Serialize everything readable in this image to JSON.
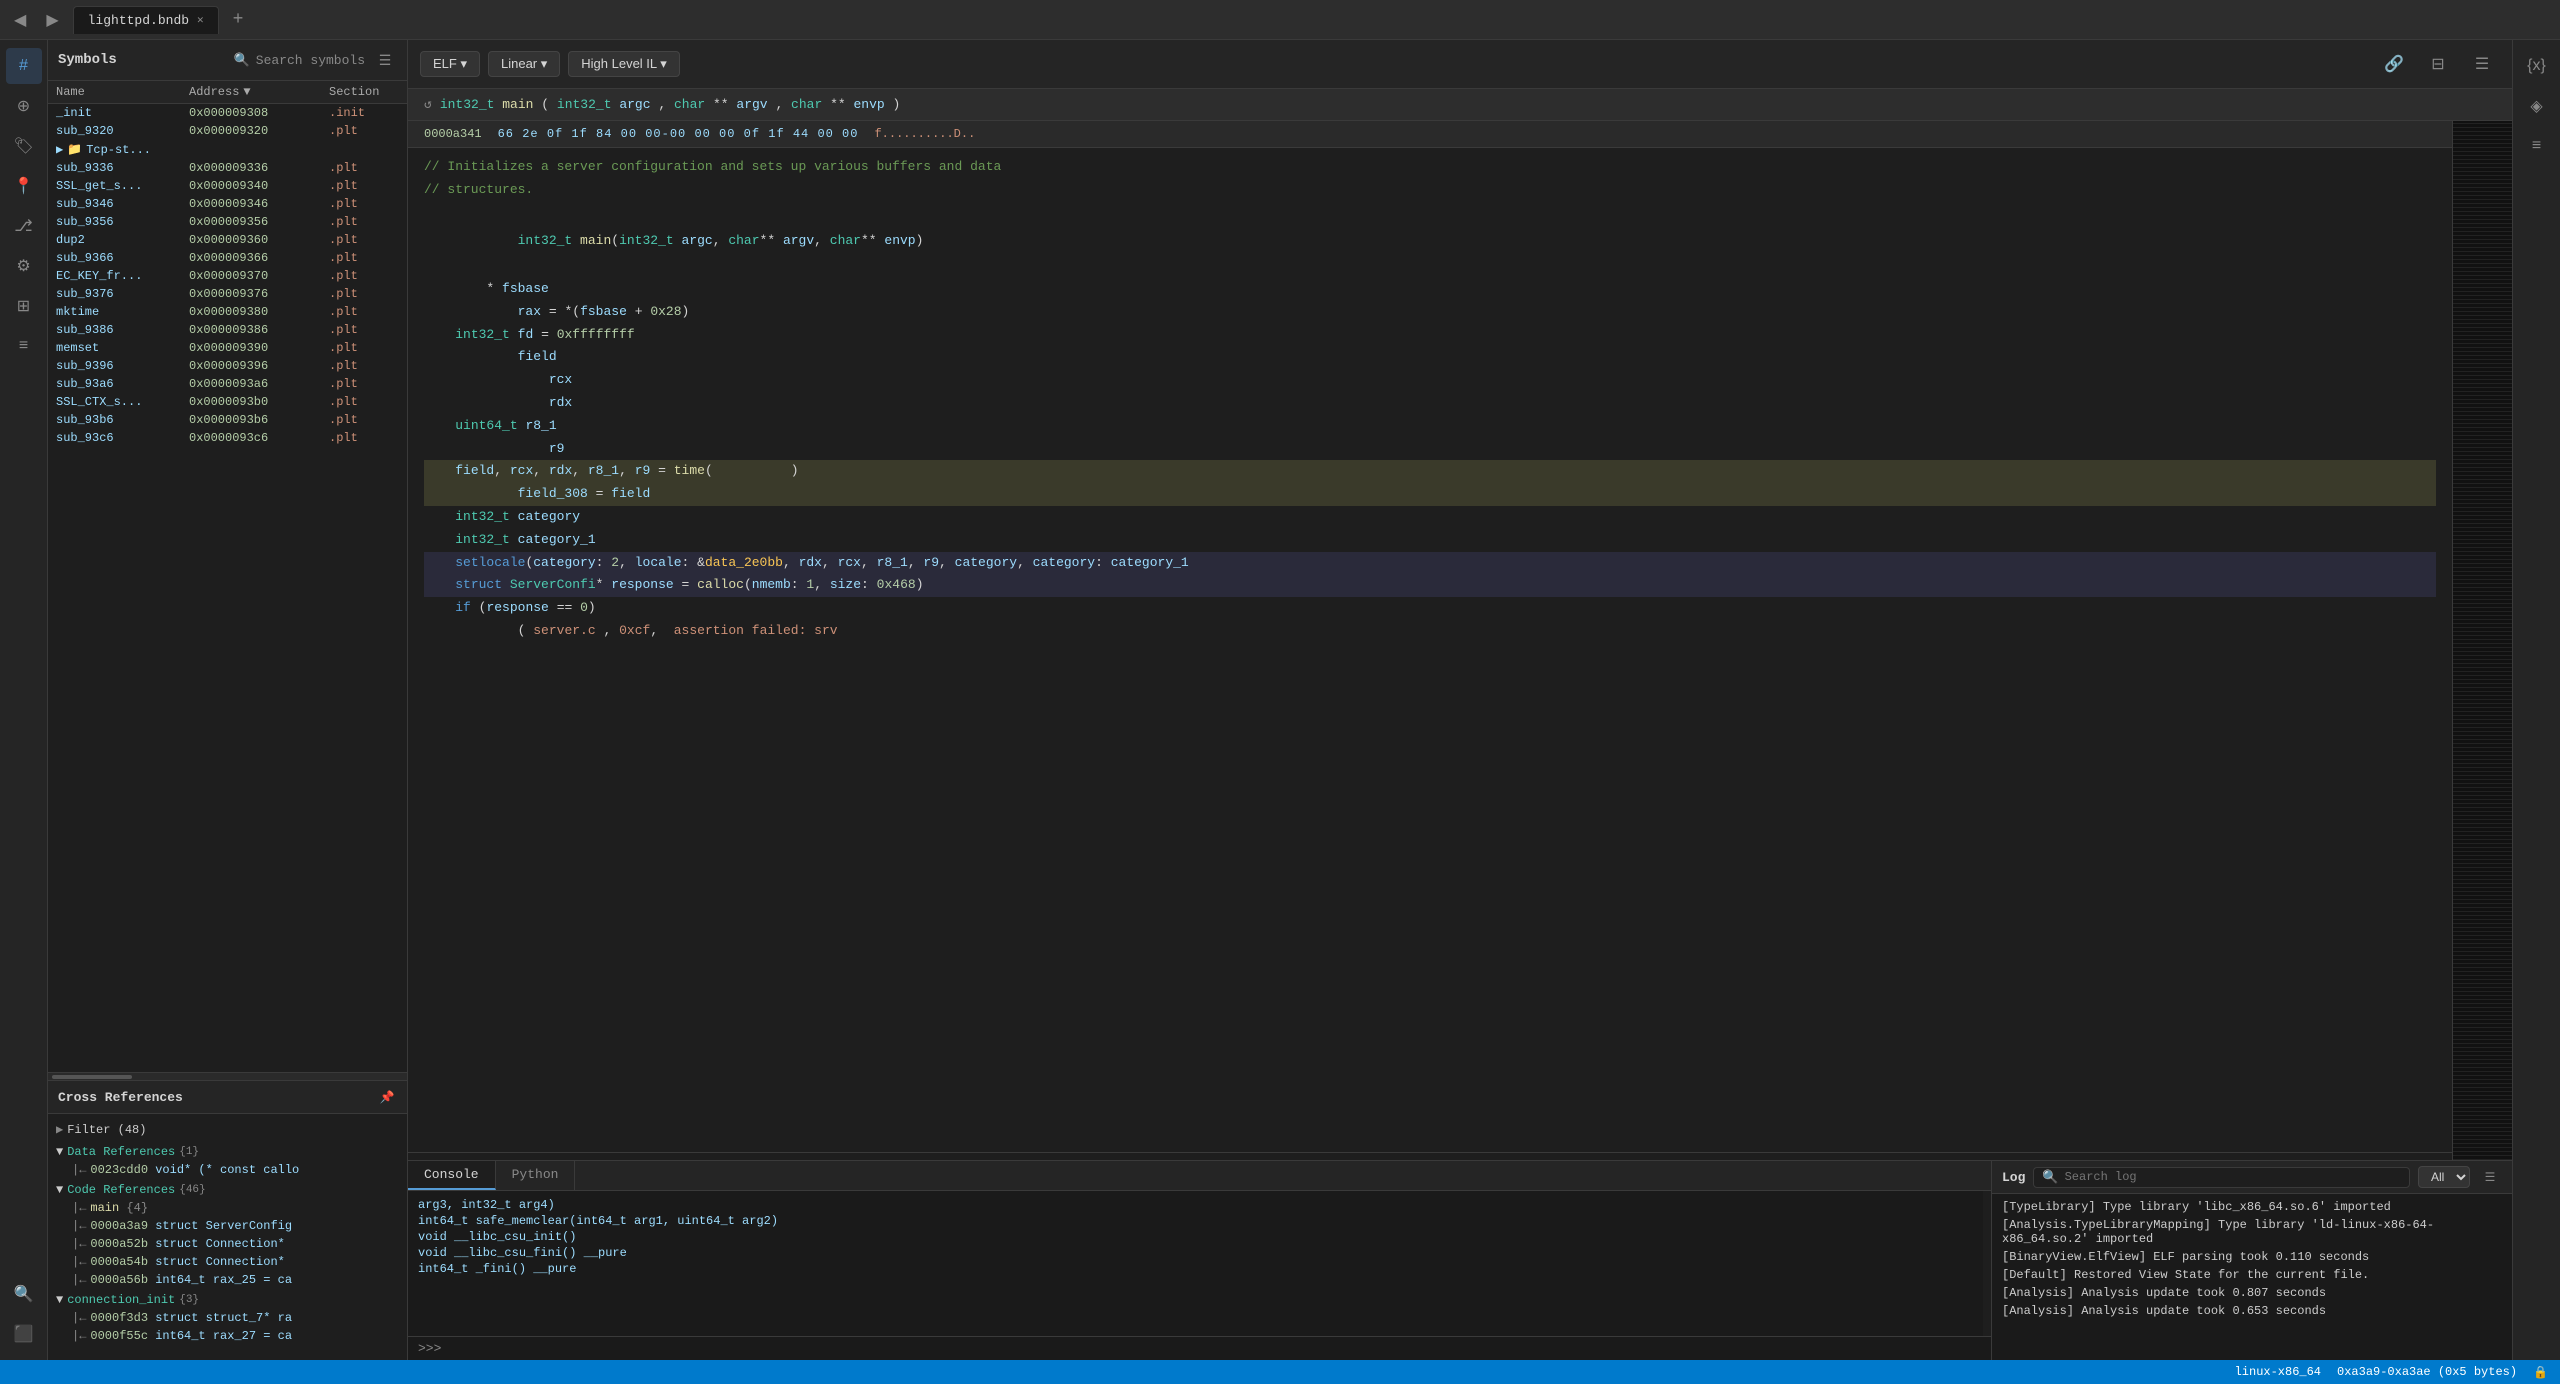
{
  "topbar": {
    "back_label": "◀",
    "forward_label": "▶",
    "tab_name": "lighttpd.bndb",
    "tab_close": "✕",
    "tab_add": "+"
  },
  "toolbar": {
    "elf_label": "ELF ▾",
    "linear_label": "Linear ▾",
    "hlil_label": "High Level IL ▾",
    "link_icon": "🔗",
    "split_icon": "⊟",
    "menu_icon": "☰"
  },
  "func_sig": {
    "refresh_icon": "↺",
    "signature": "int32_t main(int32_t argc, char** argv, char** envp)"
  },
  "hex_row": {
    "addr": "0000a341",
    "bytes": "66 2e 0f 1f 84 00 00-00 00 00 0f 1f 44 00 00",
    "ascii": "f..........D.."
  },
  "symbols": {
    "title": "Symbols",
    "search_placeholder": "Search symbols",
    "columns": [
      "Name",
      "Address",
      "Section"
    ],
    "rows": [
      {
        "name": "_init",
        "addr": "0x000009308",
        "section": ".init"
      },
      {
        "name": "sub_9320",
        "addr": "0x000009320",
        "section": ".plt"
      },
      {
        "name": "Tcp-st...",
        "addr": "",
        "section": "",
        "is_folder": true
      },
      {
        "name": "sub_9336",
        "addr": "0x000009336",
        "section": ".plt"
      },
      {
        "name": "SSL_get_s...",
        "addr": "0x000009340",
        "section": ".plt"
      },
      {
        "name": "sub_9346",
        "addr": "0x000009346",
        "section": ".plt"
      },
      {
        "name": "sub_9356",
        "addr": "0x000009356",
        "section": ".plt"
      },
      {
        "name": "dup2",
        "addr": "0x000009360",
        "section": ".plt"
      },
      {
        "name": "sub_9366",
        "addr": "0x000009366",
        "section": ".plt"
      },
      {
        "name": "EC_KEY_fr...",
        "addr": "0x000009370",
        "section": ".plt"
      },
      {
        "name": "sub_9376",
        "addr": "0x000009376",
        "section": ".plt"
      },
      {
        "name": "mktime",
        "addr": "0x000009380",
        "section": ".plt"
      },
      {
        "name": "sub_9386",
        "addr": "0x000009386",
        "section": ".plt"
      },
      {
        "name": "memset",
        "addr": "0x000009390",
        "section": ".plt"
      },
      {
        "name": "sub_9396",
        "addr": "0x000009396",
        "section": ".plt"
      },
      {
        "name": "sub_93a6",
        "addr": "0x0000093a6",
        "section": ".plt"
      },
      {
        "name": "SSL_CTX_s...",
        "addr": "0x0000093b0",
        "section": ".plt"
      },
      {
        "name": "sub_93b6",
        "addr": "0x0000093b6",
        "section": ".plt"
      },
      {
        "name": "sub_93c6",
        "addr": "0x0000093c6",
        "section": ".plt"
      }
    ]
  },
  "cross_refs": {
    "title": "Cross References",
    "filter_label": "Filter (48)",
    "sections": [
      {
        "name": "Data References",
        "count": "{1}",
        "items": [
          "0023cdd0 void* (* const callo"
        ]
      },
      {
        "name": "Code References",
        "count": "{46}",
        "items": [
          "main  {4}",
          "0000a3a9 struct ServerConfig",
          "0000a52b struct Connection*",
          "0000a54b struct Connection*",
          "0000a56b int64_t rax_25 = ca"
        ]
      },
      {
        "name": "connection_init",
        "count": "{3}",
        "items": [
          "0000f3d3 struct struct_7* ra",
          "0000f55c int64_t rax_27 = ca"
        ]
      }
    ]
  },
  "code": {
    "comment1": "// Initializes a server configuration and sets up various buffers and data",
    "comment2": "// structures.",
    "lines": [
      {
        "type": "sig",
        "text": "int32_t main(int32_t argc, char** argv, char** envp) {"
      },
      {
        "type": "code",
        "text": "    * fsbase"
      },
      {
        "type": "code",
        "text": "        rax = *(fsbase + 0x28)"
      },
      {
        "type": "code",
        "text": "    int32_t fd = 0xffffffff"
      },
      {
        "type": "code",
        "text": "        field"
      },
      {
        "type": "code",
        "text": "            rcx"
      },
      {
        "type": "code",
        "text": "            rdx"
      },
      {
        "type": "code",
        "text": "    uint64_t r8_1"
      },
      {
        "type": "code",
        "text": "            r9"
      },
      {
        "type": "code_hl",
        "text": "    field, rcx, rdx, r8_1, r9 = time(          )"
      },
      {
        "type": "code_hl",
        "text": "        field_308 = field"
      },
      {
        "type": "code",
        "text": "    int32_t category"
      },
      {
        "type": "code",
        "text": "    int32_t category_1"
      },
      {
        "type": "code_hl2",
        "text": "    setlocale(category: 2, locale: &data_2e0bb, rdx, rcx, r8_1, r9, category, category: category_1"
      },
      {
        "type": "code_hl2",
        "text": "    struct ServerConfi* response = calloc(nmemb: 1, size: 0x468)"
      },
      {
        "type": "code",
        "text": "    if (response == 0)"
      },
      {
        "type": "code",
        "text": "        ( server.c , 0xcf,  assertion failed: srv"
      }
    ]
  },
  "console": {
    "tabs": [
      "Console",
      "Python"
    ],
    "active_tab": "Console",
    "output_lines": [
      "arg3, int32_t arg4)",
      "int64_t safe_memclear(int64_t arg1, uint64_t arg2)",
      "void __libc_csu_init()",
      "void __libc_csu_fini() __pure",
      "int64_t _fini() __pure"
    ],
    "prompt": ">>>",
    "input_value": ""
  },
  "log": {
    "title": "Log",
    "search_placeholder": "Search log",
    "filter_options": [
      "All"
    ],
    "lines": [
      "[TypeLibrary] Type library 'libc_x86_64.so.6' imported",
      "[Analysis.TypeLibraryMapping] Type library 'ld-linux-x86-64-\nx86_64.so.2' imported",
      "[BinaryView.ElfView] ELF parsing took 0.110 seconds",
      "[Default] Restored View State for the current file.",
      "[Analysis] Analysis update took 0.807 seconds",
      "[Analysis] Analysis update took 0.653 seconds"
    ]
  },
  "right_sidebar": {
    "icons": [
      "✕",
      "◈",
      "≡"
    ]
  },
  "status_bar": {
    "arch": "linux-x86_64",
    "addr_range": "0xa3a9-0xa3ae (0x5 bytes)",
    "lock_icon": "🔒"
  }
}
